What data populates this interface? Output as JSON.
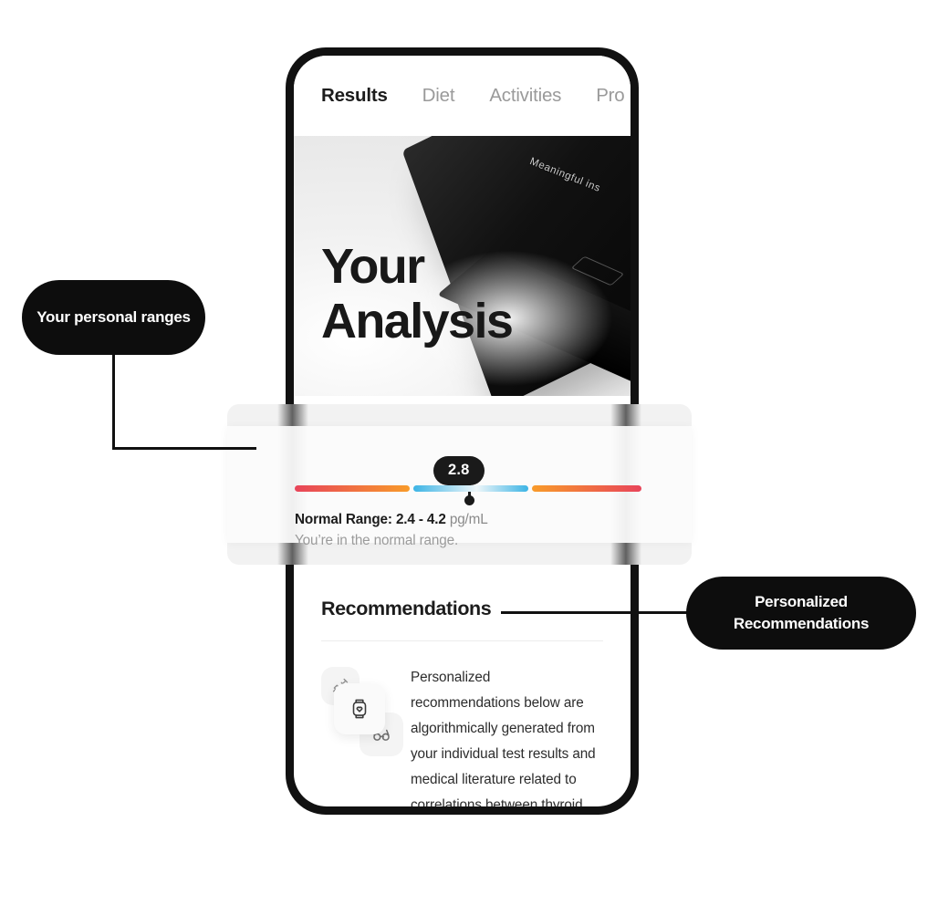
{
  "phone": {
    "tabs": [
      {
        "label": "Results",
        "active": true
      },
      {
        "label": "Diet",
        "active": false
      },
      {
        "label": "Activities",
        "active": false
      },
      {
        "label": "Pro",
        "active": false
      }
    ],
    "hero": {
      "title_line1": "Your",
      "title_line2": "Analysis",
      "box_label": "Meaningful ins"
    },
    "result": {
      "value": "2.8",
      "range_label": "Normal Range: 2.4 - 4.2",
      "unit": "pg/mL",
      "status": "You’re in the normal range.",
      "colors": {
        "low_start": "#e8445a",
        "low_end": "#f89b2a",
        "mid_edge": "#3cb4e5",
        "mid_center": "#eef6f9",
        "high_start": "#f89b2a",
        "high_end": "#e8445a",
        "bubble_bg": "#1a1a1a"
      }
    },
    "recommendations": {
      "title": "Recommendations",
      "body": "Personalized recommendations below are algorithmically generated from your individual test results and medical literature related to correlations between thyroid health and lifestyle changes.",
      "icons": [
        "syringe-icon",
        "smartwatch-heart-icon",
        "glasses-icon"
      ]
    }
  },
  "callouts": [
    {
      "id": "ranges",
      "text": "Your personal ranges"
    },
    {
      "id": "recs",
      "text": "Personalized Recommendations"
    }
  ],
  "theme": {
    "accent_dark": "#0d0d0d",
    "page_bg": "#ffffff",
    "card_bg": "#f2f2f2"
  }
}
